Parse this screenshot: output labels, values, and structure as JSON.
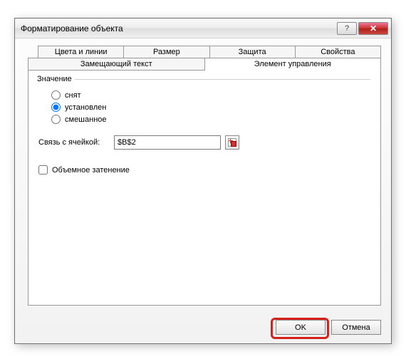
{
  "title": "Форматирование объекта",
  "tabs_row1": [
    {
      "label": "Цвета и линии"
    },
    {
      "label": "Размер"
    },
    {
      "label": "Защита"
    },
    {
      "label": "Свойства"
    }
  ],
  "tabs_row2": [
    {
      "label": "Замещающий текст",
      "active": false
    },
    {
      "label": "Элемент управления",
      "active": true
    }
  ],
  "group": {
    "legend": "Значение",
    "options": {
      "unset": "снят",
      "set": "установлен",
      "mixed": "смешанное"
    },
    "selected": "set"
  },
  "cell_link": {
    "label": "Связь с ячейкой:",
    "value": "$B$2"
  },
  "shade3d": {
    "label": "Объемное затенение",
    "checked": false
  },
  "buttons": {
    "ok": "OK",
    "cancel": "Отмена"
  },
  "titlebar": {
    "help": "?",
    "close": "✕"
  }
}
